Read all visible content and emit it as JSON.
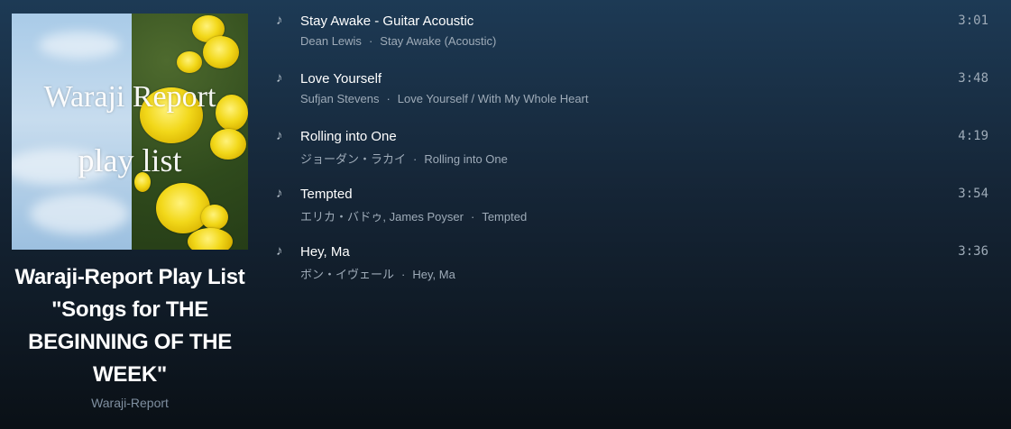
{
  "playlist": {
    "cover_line1": "Waraji Report",
    "cover_line2": "play list",
    "title": "Waraji-Report Play List \"Songs for THE BEGINNING OF THE WEEK\"",
    "owner": "Waraji-Report"
  },
  "colors": {
    "background_top": "#1d3a55",
    "background_bottom": "#0a1016",
    "secondary_text": "#9eabb8",
    "flower_yellow": "#f2d81a"
  },
  "track_icon": "music-note-icon",
  "tracks": [
    {
      "name": "Stay Awake - Guitar Acoustic",
      "artist": "Dean Lewis",
      "album": "Stay Awake (Acoustic)",
      "duration": "3:01"
    },
    {
      "name": "Love Yourself",
      "artist": "Sufjan Stevens",
      "album": "Love Yourself / With My Whole Heart",
      "duration": "3:48"
    },
    {
      "name": "Rolling into One",
      "artist": "ジョーダン・ラカイ",
      "album": "Rolling into One",
      "duration": "4:19"
    },
    {
      "name": "Tempted",
      "artist": "エリカ・バドゥ, James Poyser",
      "album": "Tempted",
      "duration": "3:54"
    },
    {
      "name": "Hey, Ma",
      "artist": "ボン・イヴェール",
      "album": "Hey, Ma",
      "duration": "3:36"
    }
  ]
}
